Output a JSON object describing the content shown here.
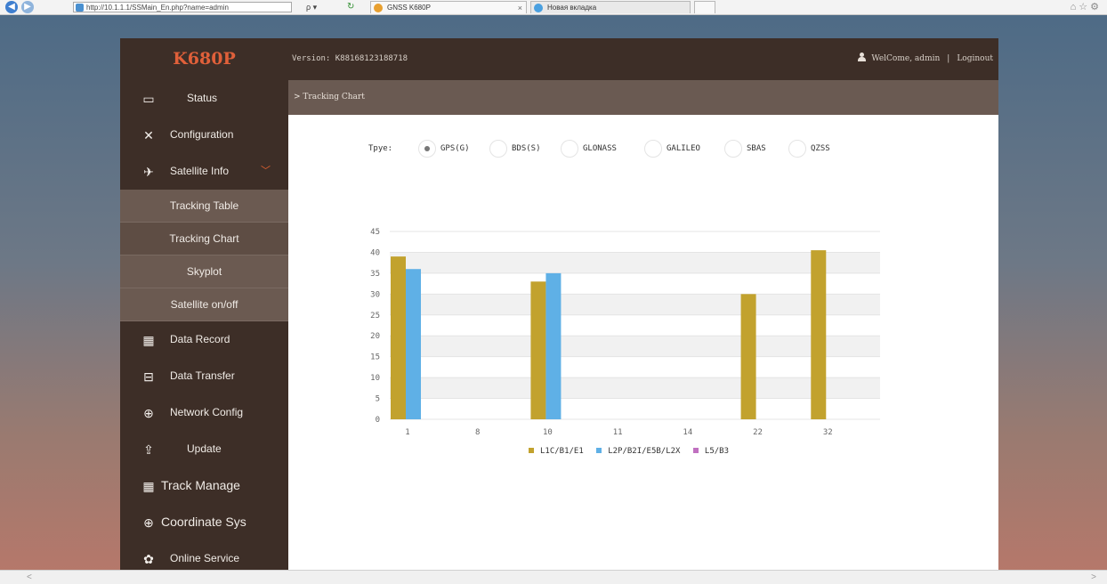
{
  "browser": {
    "address": "http://10.1.1.1/SSMain_En.php?name=admin",
    "search_symbol": "ρ ▾",
    "tabs": [
      {
        "label": "GNSS K680P",
        "close": "×"
      },
      {
        "label": "Новая вкладка"
      }
    ]
  },
  "app": {
    "logo": "K680P",
    "version": "Version: K88168123188718",
    "welcome": "WelCome, admin",
    "separator": "|",
    "logout": "Loginout"
  },
  "sidebar": {
    "items": [
      {
        "label": "Status",
        "icon": "monitor-icon"
      },
      {
        "label": "Configuration",
        "icon": "tools-icon"
      },
      {
        "label": "Satellite Info",
        "icon": "satellite-icon"
      },
      {
        "label": "Data Record",
        "icon": "calendar-icon"
      },
      {
        "label": "Data Transfer",
        "icon": "network-icon"
      },
      {
        "label": "Network Config",
        "icon": "globe-icon"
      },
      {
        "label": "Update",
        "icon": "upload-icon"
      },
      {
        "label": "Track Manage",
        "icon": "calendar-icon"
      },
      {
        "label": "Coordinate Sys",
        "icon": "globe-icon"
      },
      {
        "label": "Online Service",
        "icon": "service-icon"
      }
    ],
    "submenu": [
      "Tracking Table",
      "Tracking Chart",
      "Skyplot",
      "Satellite on/off"
    ],
    "active_submenu": "Tracking Chart"
  },
  "breadcrumb": "> Tracking Chart",
  "type_selector": {
    "label": "Tpye:",
    "options": [
      "GPS(G)",
      "BDS(S)",
      "GLONASS",
      "GALILEO",
      "SBAS",
      "QZSS"
    ],
    "selected": "GPS(G)"
  },
  "colors": {
    "L1": "#c2a22e",
    "L2": "#5fb0e6",
    "L5": "#c070c0",
    "accent": "#e0603a"
  },
  "chart_data": {
    "type": "bar",
    "categories": [
      "1",
      "8",
      "10",
      "11",
      "14",
      "22",
      "32"
    ],
    "ylim": [
      0,
      45
    ],
    "yticks": [
      0,
      5,
      10,
      15,
      20,
      25,
      30,
      35,
      40,
      45
    ],
    "series": [
      {
        "name": "L1C/B1/E1",
        "values": [
          39,
          0,
          33,
          0,
          0,
          30,
          40.5
        ]
      },
      {
        "name": "L2P/B2I/E5B/L2X",
        "values": [
          36,
          0,
          35,
          0,
          0,
          0,
          0
        ]
      },
      {
        "name": "L5/B3",
        "values": [
          0,
          0,
          0,
          0,
          0,
          0,
          0
        ]
      }
    ],
    "legend": "bottom"
  }
}
